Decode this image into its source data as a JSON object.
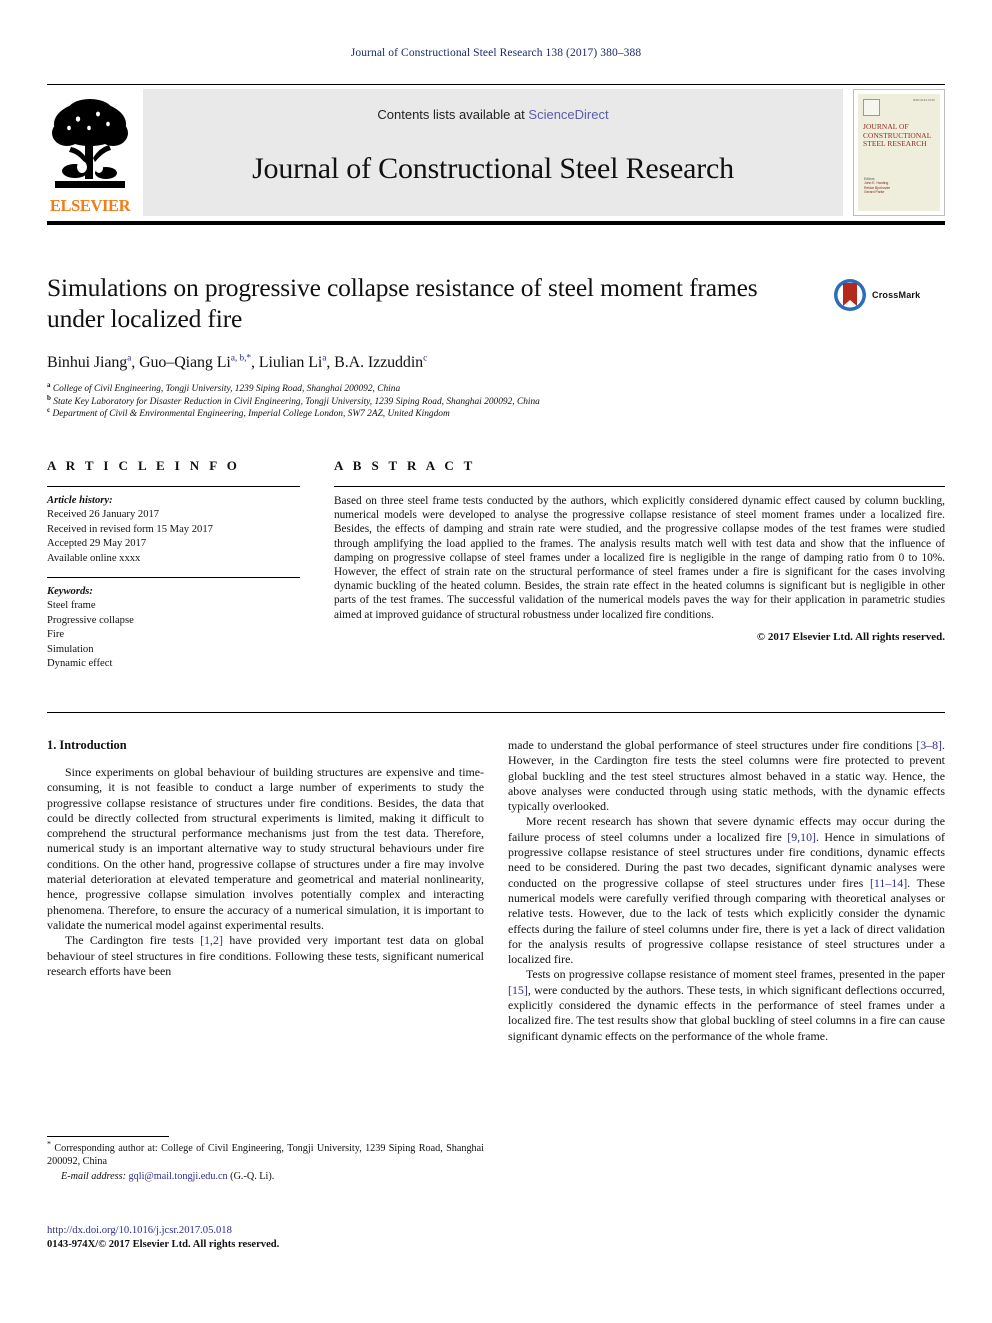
{
  "running_head": "Journal of Constructional Steel Research 138 (2017) 380–388",
  "masthead": {
    "publisher_name": "ELSEVIER",
    "contents_prefix": "Contents lists available at ",
    "sciencedirect_link": "ScienceDirect",
    "journal_title": "Journal of Constructional Steel Research",
    "cover": {
      "issn_text": "ISSN 0143-974X",
      "title_lines": "JOURNAL OF CONSTRUCTIONAL STEEL RESEARCH",
      "editors_label": "Editors",
      "editor_1": "John E. Harding",
      "editor_2": "Reidar Bjorhovde",
      "editor_3": "Gerard Parke"
    }
  },
  "article": {
    "title": "Simulations on progressive collapse resistance of steel moment frames under localized fire",
    "crossmark_label": "CrossMark",
    "authors_html": "Binhui Jiang<sup>a</sup>, Guo–Qiang Li<sup>a, b,</sup><sup>*</sup>, Liulian Li<sup>a</sup>, B.A. Izzuddin<sup>c</sup>",
    "affiliations": [
      {
        "mark": "a",
        "text": "College of Civil Engineering, Tongji University, 1239 Siping Road, Shanghai 200092, China"
      },
      {
        "mark": "b",
        "text": "State Key Laboratory for Disaster Reduction in Civil Engineering, Tongji University, 1239 Siping Road, Shanghai 200092, China"
      },
      {
        "mark": "c",
        "text": "Department of Civil & Environmental Engineering, Imperial College London, SW7 2AZ, United Kingdom"
      }
    ]
  },
  "article_info": {
    "heading": "A R T I C L E    I N F O",
    "history_title": "Article history:",
    "history": [
      "Received 26 January 2017",
      "Received in revised form 15 May 2017",
      "Accepted 29 May 2017",
      "Available online xxxx"
    ],
    "keywords_title": "Keywords:",
    "keywords": [
      "Steel frame",
      "Progressive collapse",
      "Fire",
      "Simulation",
      "Dynamic effect"
    ]
  },
  "abstract": {
    "heading": "A B S T R A C T",
    "text": "Based on three steel frame tests conducted by the authors, which explicitly considered dynamic effect caused by column buckling, numerical models were developed to analyse the progressive collapse resistance of steel moment frames under a localized fire. Besides, the effects of damping and strain rate were studied, and the progressive collapse modes of the test frames were studied through amplifying the load applied to the frames. The analysis results match well with test data and show that the influence of damping on progressive collapse of steel frames under a localized fire is negligible in the range of damping ratio from 0 to 10%. However, the effect of strain rate on the structural performance of steel frames under a fire is significant for the cases involving dynamic buckling of the heated column. Besides, the strain rate effect in the heated columns is significant but is negligible in other parts of the test frames. The successful validation of the numerical models paves the way for their application in parametric studies aimed at improved guidance of structural robustness under localized fire conditions.",
    "copyright": "© 2017 Elsevier Ltd. All rights reserved."
  },
  "body": {
    "section_title": "1. Introduction",
    "left_paragraphs": [
      "Since experiments on global behaviour of building structures are expensive and time-consuming, it is not feasible to conduct a large number of experiments to study the progressive collapse resistance of structures under fire conditions. Besides, the data that could be directly collected from structural experiments is limited, making it difficult to comprehend the structural performance mechanisms just from the test data. Therefore, numerical study is an important alternative way to study structural behaviours under fire conditions. On the other hand, progressive collapse of structures under a fire may involve material deterioration at elevated temperature and geometrical and material nonlinearity, hence, progressive collapse simulation involves potentially complex and interacting phenomena. Therefore, to ensure the accuracy of a numerical simulation, it is important to validate the numerical model against experimental results."
    ],
    "left_paragraph_2_parts": {
      "pre": "The Cardington fire tests ",
      "ref": "[1,2]",
      "post": " have provided very important test data on global behaviour of steel structures in fire conditions. Following these tests, significant numerical research efforts have been"
    },
    "right_paragraph_1_parts": {
      "pre": "made to understand the global performance of steel structures under fire conditions ",
      "ref": "[3–8]",
      "post": ". However, in the Cardington fire tests the steel columns were fire protected to prevent global buckling and the test steel structures almost behaved in a static way. Hence, the above analyses were conducted through using static methods, with the dynamic effects typically overlooked."
    },
    "right_paragraph_2_parts": {
      "pre": "More recent research has shown that severe dynamic effects may occur during the failure process of steel columns under a localized fire ",
      "ref": "[9,10]",
      "mid": ". Hence in simulations of progressive collapse resistance of steel structures under fire conditions, dynamic effects need to be considered. During the past two decades, significant dynamic analyses were conducted on the progressive collapse of steel structures under fires ",
      "ref2": "[11–14]",
      "post": ". These numerical models were carefully verified through comparing with theoretical analyses or relative tests. However, due to the lack of tests which explicitly consider the dynamic effects during the failure of steel columns under fire, there is yet a lack of direct validation for the analysis results of progressive collapse resistance of steel structures under a localized fire."
    },
    "right_paragraph_3_parts": {
      "pre": "Tests on progressive collapse resistance of moment steel frames, presented in the paper ",
      "ref": "[15]",
      "post": ", were conducted by the authors. These tests, in which significant deflections occurred, explicitly considered the dynamic effects in the performance of steel frames under a localized fire. The test results show that global buckling of steel columns in a fire can cause significant dynamic effects on the performance of the whole frame."
    }
  },
  "footnote": {
    "star": "*",
    "corresponding": " Corresponding author at: College of Civil Engineering, Tongji University, 1239 Siping Road, Shanghai 200092, China",
    "email_label": "E-mail address:",
    "email": "gqli@mail.tongji.edu.cn",
    "email_suffix": " (G.-Q. Li)."
  },
  "footer": {
    "doi": "http://dx.doi.org/10.1016/j.jcsr.2017.05.018",
    "issn_copyright": "0143-974X/© 2017 Elsevier Ltd. All rights reserved."
  },
  "colors": {
    "link_blue": "#2d2d8f",
    "sciencedirect": "#5b5bb0",
    "elsevier_orange": "#ef7d1a",
    "crossmark_blue": "#2a6ebb",
    "crossmark_red": "#b5281e",
    "cover_cream": "#efeddb",
    "cover_red": "#8a2b20"
  }
}
